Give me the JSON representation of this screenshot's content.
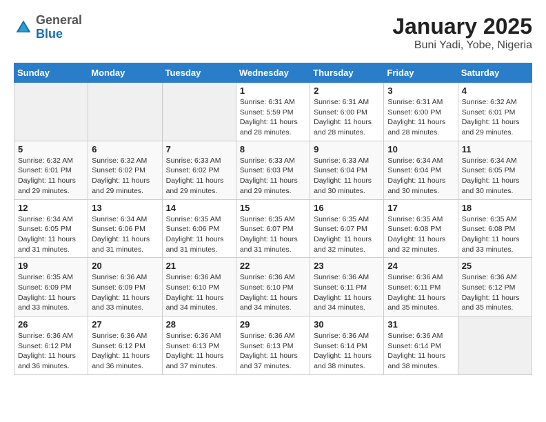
{
  "header": {
    "logo": {
      "general": "General",
      "blue": "Blue"
    },
    "title": "January 2025",
    "subtitle": "Buni Yadi, Yobe, Nigeria"
  },
  "days_of_week": [
    "Sunday",
    "Monday",
    "Tuesday",
    "Wednesday",
    "Thursday",
    "Friday",
    "Saturday"
  ],
  "weeks": [
    [
      {
        "day": "",
        "sunrise": "",
        "sunset": "",
        "daylight": ""
      },
      {
        "day": "",
        "sunrise": "",
        "sunset": "",
        "daylight": ""
      },
      {
        "day": "",
        "sunrise": "",
        "sunset": "",
        "daylight": ""
      },
      {
        "day": "1",
        "sunrise": "Sunrise: 6:31 AM",
        "sunset": "Sunset: 5:59 PM",
        "daylight": "Daylight: 11 hours and 28 minutes."
      },
      {
        "day": "2",
        "sunrise": "Sunrise: 6:31 AM",
        "sunset": "Sunset: 6:00 PM",
        "daylight": "Daylight: 11 hours and 28 minutes."
      },
      {
        "day": "3",
        "sunrise": "Sunrise: 6:31 AM",
        "sunset": "Sunset: 6:00 PM",
        "daylight": "Daylight: 11 hours and 28 minutes."
      },
      {
        "day": "4",
        "sunrise": "Sunrise: 6:32 AM",
        "sunset": "Sunset: 6:01 PM",
        "daylight": "Daylight: 11 hours and 29 minutes."
      }
    ],
    [
      {
        "day": "5",
        "sunrise": "Sunrise: 6:32 AM",
        "sunset": "Sunset: 6:01 PM",
        "daylight": "Daylight: 11 hours and 29 minutes."
      },
      {
        "day": "6",
        "sunrise": "Sunrise: 6:32 AM",
        "sunset": "Sunset: 6:02 PM",
        "daylight": "Daylight: 11 hours and 29 minutes."
      },
      {
        "day": "7",
        "sunrise": "Sunrise: 6:33 AM",
        "sunset": "Sunset: 6:02 PM",
        "daylight": "Daylight: 11 hours and 29 minutes."
      },
      {
        "day": "8",
        "sunrise": "Sunrise: 6:33 AM",
        "sunset": "Sunset: 6:03 PM",
        "daylight": "Daylight: 11 hours and 29 minutes."
      },
      {
        "day": "9",
        "sunrise": "Sunrise: 6:33 AM",
        "sunset": "Sunset: 6:04 PM",
        "daylight": "Daylight: 11 hours and 30 minutes."
      },
      {
        "day": "10",
        "sunrise": "Sunrise: 6:34 AM",
        "sunset": "Sunset: 6:04 PM",
        "daylight": "Daylight: 11 hours and 30 minutes."
      },
      {
        "day": "11",
        "sunrise": "Sunrise: 6:34 AM",
        "sunset": "Sunset: 6:05 PM",
        "daylight": "Daylight: 11 hours and 30 minutes."
      }
    ],
    [
      {
        "day": "12",
        "sunrise": "Sunrise: 6:34 AM",
        "sunset": "Sunset: 6:05 PM",
        "daylight": "Daylight: 11 hours and 31 minutes."
      },
      {
        "day": "13",
        "sunrise": "Sunrise: 6:34 AM",
        "sunset": "Sunset: 6:06 PM",
        "daylight": "Daylight: 11 hours and 31 minutes."
      },
      {
        "day": "14",
        "sunrise": "Sunrise: 6:35 AM",
        "sunset": "Sunset: 6:06 PM",
        "daylight": "Daylight: 11 hours and 31 minutes."
      },
      {
        "day": "15",
        "sunrise": "Sunrise: 6:35 AM",
        "sunset": "Sunset: 6:07 PM",
        "daylight": "Daylight: 11 hours and 31 minutes."
      },
      {
        "day": "16",
        "sunrise": "Sunrise: 6:35 AM",
        "sunset": "Sunset: 6:07 PM",
        "daylight": "Daylight: 11 hours and 32 minutes."
      },
      {
        "day": "17",
        "sunrise": "Sunrise: 6:35 AM",
        "sunset": "Sunset: 6:08 PM",
        "daylight": "Daylight: 11 hours and 32 minutes."
      },
      {
        "day": "18",
        "sunrise": "Sunrise: 6:35 AM",
        "sunset": "Sunset: 6:08 PM",
        "daylight": "Daylight: 11 hours and 33 minutes."
      }
    ],
    [
      {
        "day": "19",
        "sunrise": "Sunrise: 6:35 AM",
        "sunset": "Sunset: 6:09 PM",
        "daylight": "Daylight: 11 hours and 33 minutes."
      },
      {
        "day": "20",
        "sunrise": "Sunrise: 6:36 AM",
        "sunset": "Sunset: 6:09 PM",
        "daylight": "Daylight: 11 hours and 33 minutes."
      },
      {
        "day": "21",
        "sunrise": "Sunrise: 6:36 AM",
        "sunset": "Sunset: 6:10 PM",
        "daylight": "Daylight: 11 hours and 34 minutes."
      },
      {
        "day": "22",
        "sunrise": "Sunrise: 6:36 AM",
        "sunset": "Sunset: 6:10 PM",
        "daylight": "Daylight: 11 hours and 34 minutes."
      },
      {
        "day": "23",
        "sunrise": "Sunrise: 6:36 AM",
        "sunset": "Sunset: 6:11 PM",
        "daylight": "Daylight: 11 hours and 34 minutes."
      },
      {
        "day": "24",
        "sunrise": "Sunrise: 6:36 AM",
        "sunset": "Sunset: 6:11 PM",
        "daylight": "Daylight: 11 hours and 35 minutes."
      },
      {
        "day": "25",
        "sunrise": "Sunrise: 6:36 AM",
        "sunset": "Sunset: 6:12 PM",
        "daylight": "Daylight: 11 hours and 35 minutes."
      }
    ],
    [
      {
        "day": "26",
        "sunrise": "Sunrise: 6:36 AM",
        "sunset": "Sunset: 6:12 PM",
        "daylight": "Daylight: 11 hours and 36 minutes."
      },
      {
        "day": "27",
        "sunrise": "Sunrise: 6:36 AM",
        "sunset": "Sunset: 6:12 PM",
        "daylight": "Daylight: 11 hours and 36 minutes."
      },
      {
        "day": "28",
        "sunrise": "Sunrise: 6:36 AM",
        "sunset": "Sunset: 6:13 PM",
        "daylight": "Daylight: 11 hours and 37 minutes."
      },
      {
        "day": "29",
        "sunrise": "Sunrise: 6:36 AM",
        "sunset": "Sunset: 6:13 PM",
        "daylight": "Daylight: 11 hours and 37 minutes."
      },
      {
        "day": "30",
        "sunrise": "Sunrise: 6:36 AM",
        "sunset": "Sunset: 6:14 PM",
        "daylight": "Daylight: 11 hours and 38 minutes."
      },
      {
        "day": "31",
        "sunrise": "Sunrise: 6:36 AM",
        "sunset": "Sunset: 6:14 PM",
        "daylight": "Daylight: 11 hours and 38 minutes."
      },
      {
        "day": "",
        "sunrise": "",
        "sunset": "",
        "daylight": ""
      }
    ]
  ]
}
